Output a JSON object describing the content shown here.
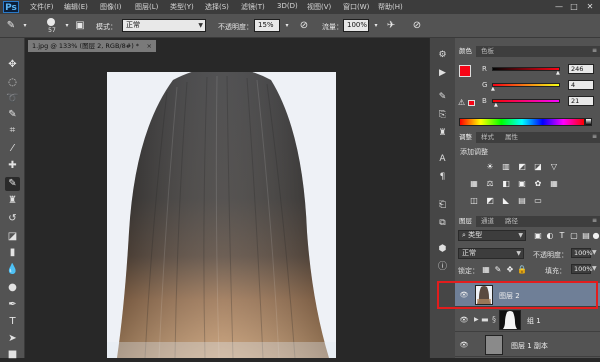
{
  "app": {
    "logo": "Ps"
  },
  "menu": [
    "文件(F)",
    "编辑(E)",
    "图像(I)",
    "图层(L)",
    "类型(Y)",
    "选择(S)",
    "滤镜(T)",
    "3D(D)",
    "视图(V)",
    "窗口(W)",
    "帮助(H)"
  ],
  "window_controls": {
    "minimize": "—",
    "maximize": "□",
    "close": "✕"
  },
  "options": {
    "brush_size": "57",
    "mode_label": "模式：",
    "mode_value": "正常",
    "opacity_label": "不透明度：",
    "opacity_value": "15%",
    "flow_label": "流量：",
    "flow_value": "100%"
  },
  "document": {
    "tab_title": "1.jpg @ 133% (图层 2, RGB/8#) *",
    "close": "×"
  },
  "color_panel": {
    "tabs": [
      "颜色",
      "色板"
    ],
    "r_label": "R",
    "r_value": "246",
    "g_label": "G",
    "g_value": "4",
    "b_label": "B",
    "b_value": "21",
    "fg_color": "#f60415",
    "bg_color": "#ffffff"
  },
  "adjust_panel": {
    "tabs": [
      "调整",
      "样式",
      "属性"
    ],
    "title": "添加调整"
  },
  "layers_panel": {
    "tabs": [
      "图层",
      "通道",
      "路径"
    ],
    "filter_label": "类型",
    "blend_mode": "正常",
    "opacity_label": "不透明度：",
    "opacity_value": "100%",
    "lock_label": "锁定：",
    "fill_label": "填充：",
    "fill_value": "100%",
    "layers": [
      {
        "name": "图层 2",
        "selected": true
      },
      {
        "name": "组 1",
        "selected": false
      },
      {
        "name": "图层 1 副本",
        "selected": false
      }
    ]
  },
  "colors": {
    "selected_layer": "#6f7f97",
    "highlight_outline": "#e21d1d"
  }
}
